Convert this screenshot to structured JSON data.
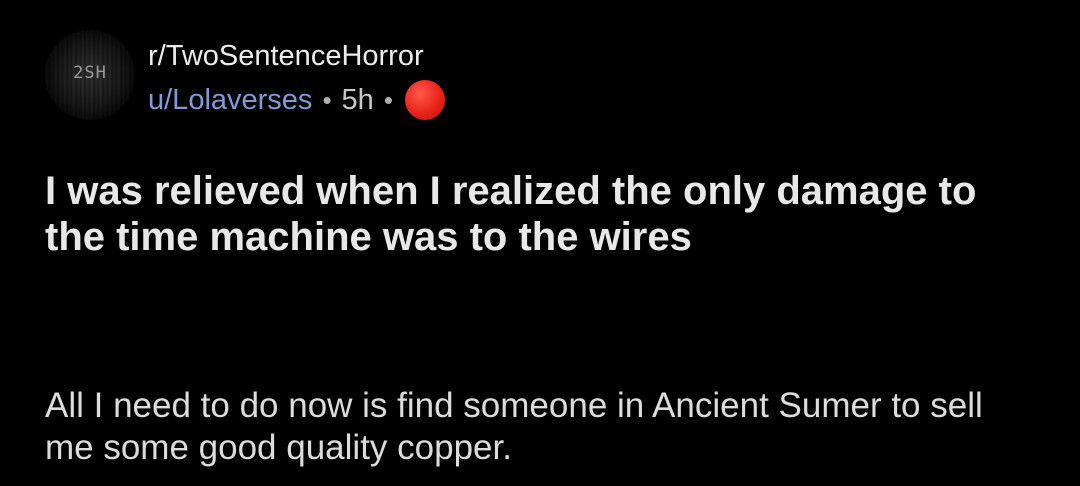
{
  "post": {
    "avatar_text": "2SH",
    "subreddit": "r/TwoSentenceHorror",
    "username": "u/Lolaverses",
    "separator": "•",
    "age": "5h",
    "title": "I was relieved when I realized the only damage to the time machine was to the wires",
    "body": "All I need to do now is find someone in Ancient Sumer to sell me some good quality copper."
  },
  "colors": {
    "background": "#000000",
    "username": "#7f9bd6",
    "badge": "#e8231a"
  }
}
